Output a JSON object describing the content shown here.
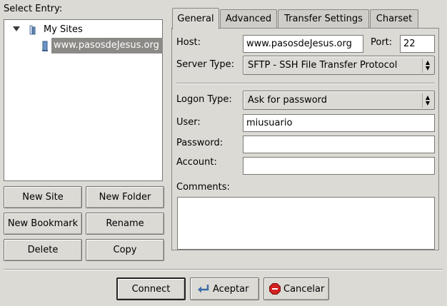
{
  "left": {
    "select_entry_label": "Select Entry:",
    "tree": {
      "root_label": "My Sites",
      "child_label": "www.pasosdeJesus.org"
    },
    "buttons": {
      "new_site": "New Site",
      "new_folder": "New Folder",
      "new_bookmark": "New Bookmark",
      "rename": "Rename",
      "delete": "Delete",
      "copy": "Copy"
    }
  },
  "tabs": [
    "General",
    "Advanced",
    "Transfer Settings",
    "Charset"
  ],
  "general": {
    "host_label": "Host:",
    "host_value": "www.pasosdeJesus.org",
    "port_label": "Port:",
    "port_value": "22",
    "server_type_label": "Server Type:",
    "server_type_value": "SFTP - SSH File Transfer Protocol",
    "logon_type_label": "Logon Type:",
    "logon_type_value": "Ask for password",
    "user_label": "User:",
    "user_value": "miusuario",
    "password_label": "Password:",
    "password_value": "",
    "account_label": "Account:",
    "account_value": "",
    "comments_label": "Comments:",
    "comments_value": ""
  },
  "footer": {
    "connect": "Connect",
    "accept": "Aceptar",
    "cancel": "Cancelar"
  },
  "colors": {
    "background": "#dcdad5",
    "selection": "#8c8a86",
    "cancel_icon": "#d42020"
  }
}
